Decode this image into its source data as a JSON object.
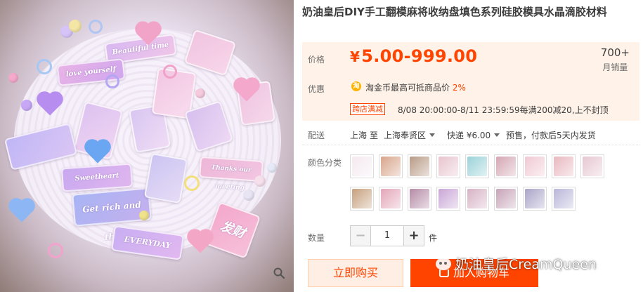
{
  "product": {
    "title": "奶油皇后DIY手工翻模麻将收纳盘填色系列硅胶模具水晶滴胶材料"
  },
  "photo": {
    "tag_texts": [
      "Beautiful time",
      "love yourself",
      "Sweetheart",
      "Get rich and thin",
      "EVERYDAY",
      "Thanks our meeting",
      "发财"
    ],
    "zoom_icon": "magnifier-icon"
  },
  "price": {
    "label": "价格",
    "currency": "¥",
    "value": "5.00-999.00",
    "sales_count": "700+",
    "sales_label": "月销量"
  },
  "promo": {
    "label": "优惠",
    "coin_icon": "淘",
    "coin_text": "淘金币最高可抵商品价",
    "coin_pct": "2%",
    "tag": "跨店满减",
    "time_text": "8/08 20:00:00-8/11 23:59:59每满200减20,上不封顶"
  },
  "shipping": {
    "label": "配送",
    "from": "上海",
    "to_word": "至",
    "to": "上海奉贤区",
    "method": "快递 ¥6.00",
    "presale": "预售，付款后5天内发货"
  },
  "color": {
    "label": "颜色分类",
    "swatch_colors": [
      "#f4e9f0",
      "#d8a58c",
      "#b89a86",
      "#e8c4cf",
      "#9ad2d8",
      "#d4a6b4",
      "#f0c9d3",
      "#e8b8bf",
      "#e7c7d2",
      "#c6a07d",
      "#e3a6b9",
      "#b58ba6",
      "#c9a6d6",
      "#d7b2c4",
      "#c6a4b8",
      "#a9a4c8",
      "#b9b6d8"
    ]
  },
  "quantity": {
    "label": "数量",
    "minus": "−",
    "value": "1",
    "plus": "+",
    "unit": "件"
  },
  "actions": {
    "buy_now": "立即购买",
    "add_cart": "加入购物车"
  },
  "watermark": {
    "text": "奶油皇后CreamQueen"
  },
  "colors": {
    "accent": "#ff4400",
    "price_bg": "#fff2e8"
  }
}
